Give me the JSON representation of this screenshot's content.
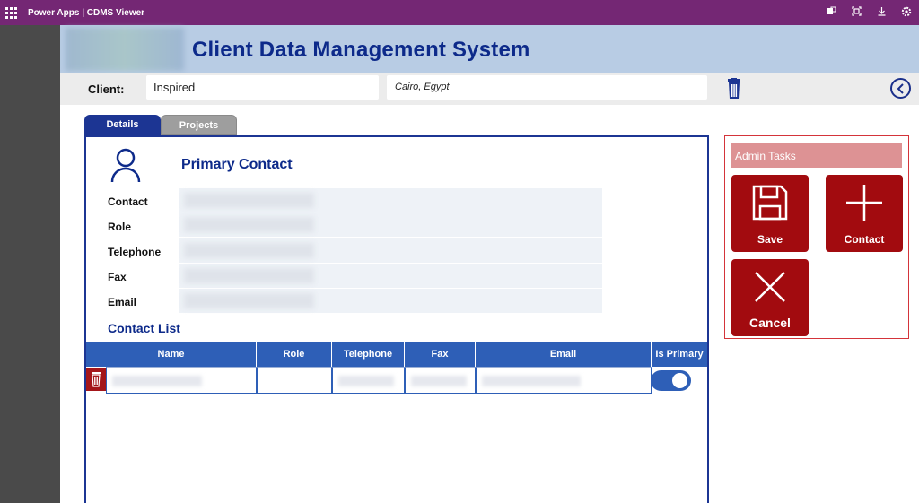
{
  "topbar": {
    "app_title": "Power Apps  |  CDMS Viewer",
    "icons": [
      "app-icon",
      "fit-screen-icon",
      "download-icon",
      "settings-icon"
    ]
  },
  "header": {
    "title": "Client Data Management System"
  },
  "client": {
    "label": "Client:",
    "name": "Inspired",
    "location": "Cairo, Egypt"
  },
  "tabs": [
    {
      "label": "Details",
      "active": true
    },
    {
      "label": "Projects",
      "active": false
    }
  ],
  "primary_contact": {
    "title": "Primary Contact",
    "fields": [
      {
        "label": "Contact"
      },
      {
        "label": "Role"
      },
      {
        "label": "Telephone"
      },
      {
        "label": "Fax"
      },
      {
        "label": "Email"
      }
    ]
  },
  "contact_list": {
    "title": "Contact List",
    "columns": [
      "Name",
      "Role",
      "Telephone",
      "Fax",
      "Email",
      "Is Primary"
    ],
    "rows": [
      {
        "is_primary": true
      }
    ]
  },
  "admin": {
    "title": "Admin Tasks",
    "buttons": {
      "save": "Save",
      "contact": "Contact",
      "cancel": "Cancel"
    }
  },
  "colors": {
    "brand_purple": "#742774",
    "header_blue": "#b8cce4",
    "title_navy": "#0d2a8a",
    "grid_blue": "#2e5fb7",
    "admin_red": "#a20b0f",
    "admin_title_pink": "#dd9294"
  }
}
